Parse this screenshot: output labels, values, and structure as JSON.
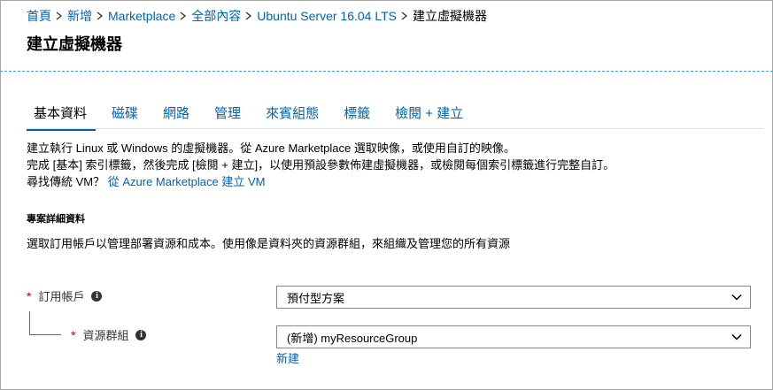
{
  "breadcrumb": {
    "items": [
      "首頁",
      "新增",
      "Marketplace",
      "全部內容",
      "Ubuntu Server 16.04 LTS"
    ],
    "current": "建立虛擬機器"
  },
  "page": {
    "title": "建立虛擬機器"
  },
  "tabs": [
    {
      "label": "基本資料",
      "active": true
    },
    {
      "label": "磁碟"
    },
    {
      "label": "網路"
    },
    {
      "label": "管理"
    },
    {
      "label": "來賓組態"
    },
    {
      "label": "標籤"
    },
    {
      "label": "檢閱 + 建立"
    }
  ],
  "description": {
    "line1": "建立執行 Linux 或 Windows 的虛擬機器。從 Azure Marketplace 選取映像，或使用自訂的映像。",
    "line2": "完成 [基本] 索引標籤，然後完成 [檢閱 + 建立]，以使用預設參數佈建虛擬機器，或檢閱每個索引標籤進行完整自訂。",
    "line3_text": "尋找傳統 VM？ ",
    "line3_link": "從 Azure Marketplace 建立 VM"
  },
  "project_details": {
    "title": "專案詳細資料",
    "description": "選取訂用帳戶以管理部署資源和成本。使用像是資料夾的資源群組，來組織及管理您的所有資源"
  },
  "subscription": {
    "required_mark": "*",
    "label": "訂用帳戶",
    "value": "預付型方案",
    "icon": "info-icon"
  },
  "resource_group": {
    "required_mark": "*",
    "label": "資源群組",
    "value": "(新增) myResourceGroup",
    "create_new": "新建",
    "icon": "info-icon"
  },
  "colors": {
    "link": "#0063b1",
    "required": "#c00000",
    "divider": "#3aa3d8"
  }
}
